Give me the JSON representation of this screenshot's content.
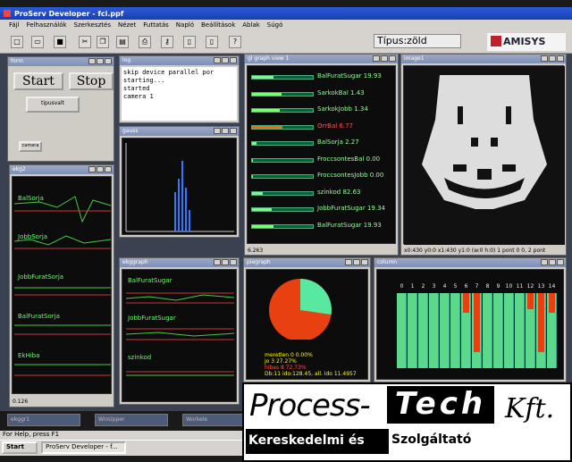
{
  "app": {
    "title": "ProServ Developer - fci.ppf",
    "menu": [
      "Fájl",
      "Felhasználók",
      "Szerkesztés",
      "Nézet",
      "Futtatás",
      "Napló",
      "Beállítások",
      "Ablak",
      "Súgó"
    ],
    "tipus": "Típus:zöld",
    "logo": "AMISYS"
  },
  "form": {
    "title": "form",
    "start": "Start",
    "stop": "Stop",
    "tipusvalt": "tipusvalt",
    "camera": "camera"
  },
  "log": {
    "title": "log",
    "lines": [
      "skip device parallel por",
      "starting...",
      "started",
      "camera 1"
    ]
  },
  "gauss": {
    "title": "gauss"
  },
  "glgraph": {
    "title": "gl graph view 1",
    "footer": "6.263",
    "rows": [
      {
        "label": "BalFuratSugar 19.93",
        "fill": 0.35,
        "alarm": false
      },
      {
        "label": "SarkokBal 1.43",
        "fill": 0.48,
        "alarm": false
      },
      {
        "label": "SarkokJobb 1.34",
        "fill": 0.45,
        "alarm": false
      },
      {
        "label": "OrrBal 6.77",
        "fill": 0.5,
        "alarm": true
      },
      {
        "label": "BalSorja 2.27",
        "fill": 0.08,
        "alarm": false
      },
      {
        "label": "FroccsontesBal 0.00",
        "fill": 0.02,
        "alarm": false
      },
      {
        "label": "FroccsontesJobb 0.00",
        "fill": 0.02,
        "alarm": false
      },
      {
        "label": "szinkod 82.63",
        "fill": 0.18,
        "alarm": false
      },
      {
        "label": "JobbFuratSugar 19.34",
        "fill": 0.33,
        "alarm": false
      },
      {
        "label": "BalFuratSugar 19.93",
        "fill": 0.35,
        "alarm": false
      }
    ]
  },
  "image1": {
    "title": "image1",
    "status": "x0:430 y0:0 x1:430 y1:0 (w:0 h:0) 1 pont 0 0, 2 pont"
  },
  "ekg2": {
    "title": "ekg2",
    "labels": [
      "BalSorja",
      "JobbSorja",
      "JobbFuratSorja",
      "BalFuratSorja",
      "EkHiba"
    ],
    "footer": "0.126"
  },
  "ekggraph": {
    "title": "ekggraph",
    "labels": [
      "BalFuratSugar",
      "JobbFuratSugar",
      "szinkod"
    ]
  },
  "piegraph": {
    "title": "piegraph",
    "line1": "meretlen 0 0.00%",
    "line2": "jo 3 27.27%",
    "line3": "hibas 8 72.73%",
    "line4": "Db:11 ido:128.45, all. ido 11.4957",
    "good_fraction": 0.2727
  },
  "column": {
    "title": "column",
    "numbers": [
      "0",
      "1",
      "2",
      "3",
      "4",
      "5",
      "6",
      "7",
      "8",
      "9",
      "10",
      "11",
      "12",
      "13",
      "14"
    ],
    "red": [
      0,
      0,
      0,
      0,
      0,
      0,
      0.25,
      0.75,
      0,
      0,
      0,
      0,
      0.2,
      0.75,
      0.25
    ]
  },
  "minimized": [
    "ekggr1",
    "WinUpper",
    "Workele"
  ],
  "status": "For Help, press F1",
  "taskbar": {
    "start": "Start",
    "item": "ProServ Developer - f..."
  },
  "brand": {
    "process": "Process-",
    "tech": "Tech",
    "kft": "Kft.",
    "sub1": "Kereskedelmi és",
    "sub2": "Szolgáltató"
  }
}
